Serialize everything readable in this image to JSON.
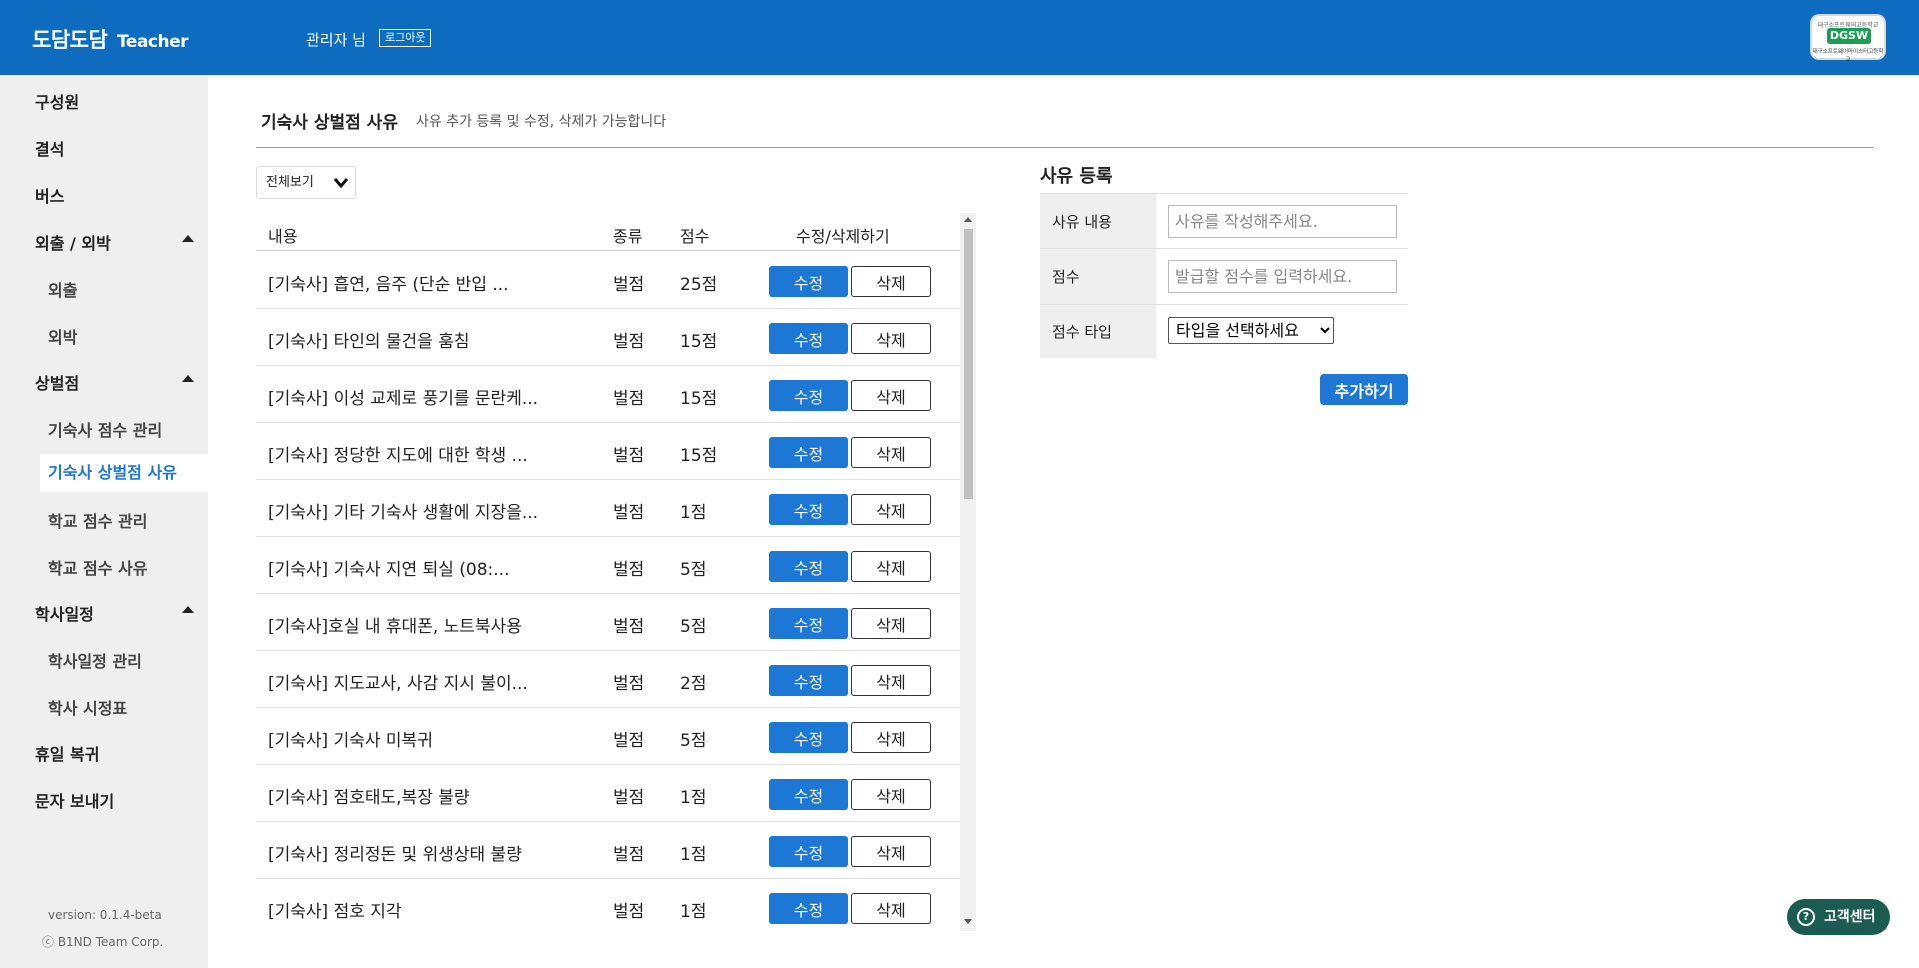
{
  "header": {
    "brand": "도담도담",
    "brand_sub": "Teacher",
    "admin_label": "관리자 님",
    "logout_label": "로그아웃",
    "logo": {
      "top": "대구소프트웨어고등학교",
      "mid": "DGSW",
      "bottom": "대구소프트웨어마이스터고등학교"
    }
  },
  "sidebar": {
    "members": "구성원",
    "absence": "결석",
    "bus": "버스",
    "outing_group": "외출 / 외박",
    "outing": "외출",
    "overnight": "외박",
    "points_group": "상벌점",
    "dorm_points": "기숙사 점수 관리",
    "dorm_reasons": "기숙사 상벌점 사유",
    "school_points": "학교 점수 관리",
    "school_reasons": "학교 점수 사유",
    "schedule_group": "학사일정",
    "schedule_manage": "학사일정 관리",
    "timetable": "학사 시정표",
    "holiday": "휴일 복귀",
    "sms": "문자 보내기",
    "version": "version: 0.1.4-beta",
    "copyright": "ⓒ B1ND Team Corp."
  },
  "page": {
    "title": "기숙사 상벌점 사유",
    "desc": "사유 추가 등록 및 수정, 삭제가 가능합니다",
    "filter": "전체보기"
  },
  "table": {
    "headers": {
      "content": "내용",
      "type": "종류",
      "score": "점수",
      "actions": "수정/삭제하기"
    },
    "edit_label": "수정",
    "delete_label": "삭제",
    "rows": [
      {
        "content": "[기숙사] 흡연, 음주 (단순 반입 ...",
        "type": "벌점",
        "score": "25점"
      },
      {
        "content": "[기숙사] 타인의 물건을 훔침",
        "type": "벌점",
        "score": "15점"
      },
      {
        "content": "[기숙사] 이성 교제로 풍기를 문란케...",
        "type": "벌점",
        "score": "15점"
      },
      {
        "content": "[기숙사] 정당한 지도에 대한 학생 ...",
        "type": "벌점",
        "score": "15점"
      },
      {
        "content": "[기숙사] 기타 기숙사 생활에 지장을...",
        "type": "벌점",
        "score": "1점"
      },
      {
        "content": "[기숙사] 기숙사 지연 퇴실 (08:...",
        "type": "벌점",
        "score": "5점"
      },
      {
        "content": "[기숙사]호실 내 휴대폰, 노트북사용",
        "type": "벌점",
        "score": "5점"
      },
      {
        "content": "[기숙사] 지도교사, 사감 지시 불이...",
        "type": "벌점",
        "score": "2점"
      },
      {
        "content": "[기숙사] 기숙사 미복귀",
        "type": "벌점",
        "score": "5점"
      },
      {
        "content": "[기숙사] 점호태도,복장 불량",
        "type": "벌점",
        "score": "1점"
      },
      {
        "content": "[기숙사] 정리정돈 및 위생상태 불량",
        "type": "벌점",
        "score": "1점"
      },
      {
        "content": "[기숙사] 점호 지각",
        "type": "벌점",
        "score": "1점"
      }
    ]
  },
  "form": {
    "title": "사유 등록",
    "reason_label": "사유 내용",
    "reason_placeholder": "사유를 작성해주세요.",
    "score_label": "점수",
    "score_placeholder": "발급할 점수를 입력하세요.",
    "type_label": "점수 타입",
    "type_selected": "타입을 선택하세요",
    "add_label": "추가하기"
  },
  "help": {
    "label": "고객센터"
  },
  "colors": {
    "primary": "#0d6cc0",
    "button": "#1d77d4",
    "sidebar": "#efefef",
    "help": "#1a5b52"
  }
}
